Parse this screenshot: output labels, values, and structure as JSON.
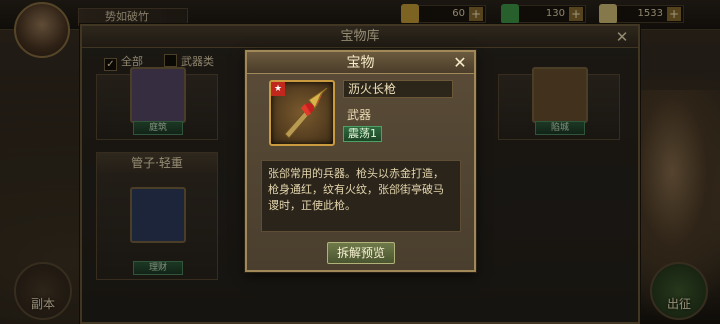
{
  "top": {
    "nickname": "势如破竹",
    "resources": [
      {
        "icon": "gold-icon",
        "value": "60",
        "color": "#c9a136"
      },
      {
        "icon": "jade-icon",
        "value": "130",
        "color": "#3f9a4a"
      },
      {
        "icon": "money-icon",
        "value": "1533",
        "color": "#d7c27a"
      }
    ]
  },
  "side": {
    "left_button": "副本",
    "right_button": "出征"
  },
  "panel": {
    "title": "宝物库",
    "filters": [
      {
        "label": "全部",
        "checked": true
      },
      {
        "label": "武器类",
        "checked": false
      }
    ],
    "cards": [
      {
        "title": "",
        "tag": "庭筑",
        "color": "#5a4a6a"
      },
      {
        "title": "",
        "tag": "陷城",
        "color": "#6a5030"
      },
      {
        "title": "管子·轻重",
        "tag": "理财",
        "color": "#2e3d5c"
      }
    ]
  },
  "popup": {
    "title": "宝物",
    "item_name": "沥火长枪",
    "item_type": "武器",
    "level": "震荡1",
    "description": "张郃常用的兵器。枪头以赤金打造，枪身通红，纹有火纹，张郃街亭破马谡时，正使此枪。",
    "preview_button": "拆解预览",
    "accent": "#c99a3e"
  }
}
